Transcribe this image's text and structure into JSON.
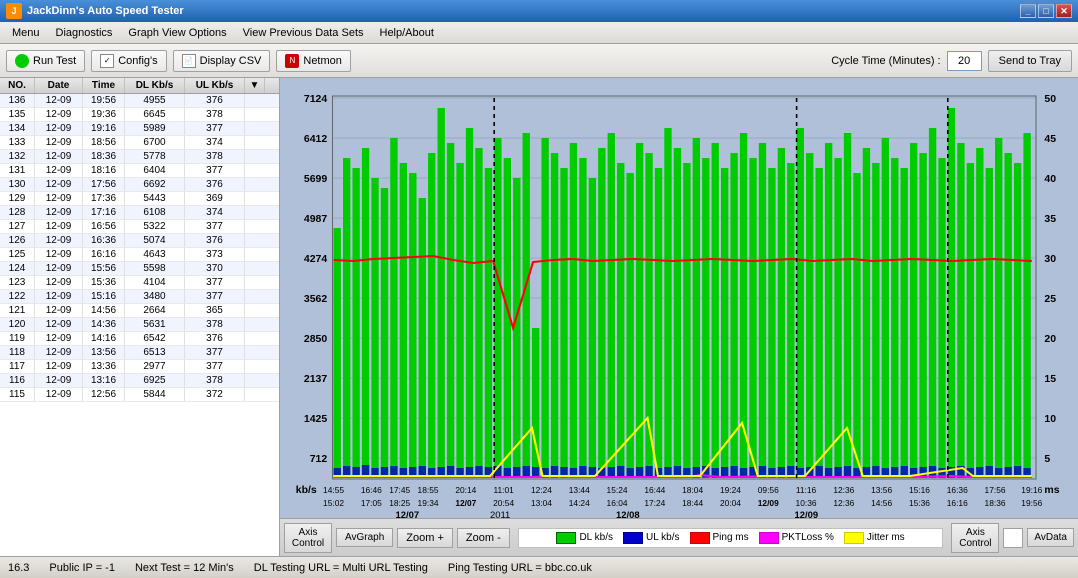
{
  "titlebar": {
    "title": "JackDinn's Auto Speed Tester",
    "controls": [
      "_",
      "□",
      "✕"
    ]
  },
  "menubar": {
    "items": [
      "Menu",
      "Diagnostics",
      "Graph View Options",
      "View Previous Data Sets",
      "Help/About"
    ]
  },
  "toolbar": {
    "run_test": "Run Test",
    "configs": "Config's",
    "display_csv": "Display CSV",
    "netmon": "Netmon",
    "cycle_time_label": "Cycle Time (Minutes) :",
    "cycle_time_value": "20",
    "send_to_tray": "Send to Tray"
  },
  "table": {
    "headers": [
      "NO.",
      "Date",
      "Time",
      "DL Kb/s",
      "UL Kb/s"
    ],
    "rows": [
      [
        "136",
        "12-09",
        "19:56",
        "4955",
        "376"
      ],
      [
        "135",
        "12-09",
        "19:36",
        "6645",
        "378"
      ],
      [
        "134",
        "12-09",
        "19:16",
        "5989",
        "377"
      ],
      [
        "133",
        "12-09",
        "18:56",
        "6700",
        "374"
      ],
      [
        "132",
        "12-09",
        "18:36",
        "5778",
        "378"
      ],
      [
        "131",
        "12-09",
        "18:16",
        "6404",
        "377"
      ],
      [
        "130",
        "12-09",
        "17:56",
        "6692",
        "376"
      ],
      [
        "129",
        "12-09",
        "17:36",
        "5443",
        "369"
      ],
      [
        "128",
        "12-09",
        "17:16",
        "6108",
        "374"
      ],
      [
        "127",
        "12-09",
        "16:56",
        "5322",
        "377"
      ],
      [
        "126",
        "12-09",
        "16:36",
        "5074",
        "376"
      ],
      [
        "125",
        "12-09",
        "16:16",
        "4643",
        "373"
      ],
      [
        "124",
        "12-09",
        "15:56",
        "5598",
        "370"
      ],
      [
        "123",
        "12-09",
        "15:36",
        "4104",
        "377"
      ],
      [
        "122",
        "12-09",
        "15:16",
        "3480",
        "377"
      ],
      [
        "121",
        "12-09",
        "14:56",
        "2664",
        "365"
      ],
      [
        "120",
        "12-09",
        "14:36",
        "5631",
        "378"
      ],
      [
        "119",
        "12-09",
        "14:16",
        "6542",
        "376"
      ],
      [
        "118",
        "12-09",
        "13:56",
        "6513",
        "377"
      ],
      [
        "117",
        "12-09",
        "13:36",
        "2977",
        "377"
      ],
      [
        "116",
        "12-09",
        "13:16",
        "6925",
        "378"
      ],
      [
        "115",
        "12-09",
        "12:56",
        "5844",
        "372"
      ]
    ]
  },
  "graph": {
    "y_labels_left": [
      "7124",
      "6412",
      "5699",
      "4987",
      "4274",
      "3562",
      "2850",
      "2137",
      "1425",
      "712",
      "kb/s"
    ],
    "y_labels_right": [
      "50",
      "45",
      "40",
      "35",
      "30",
      "25",
      "20",
      "15",
      "10",
      "5",
      "ms"
    ],
    "x_labels_top": [
      "14:55",
      "16:46",
      "17:45",
      "18:55",
      "20:14",
      "11:01",
      "12:24",
      "13:44",
      "15:24",
      "16:44",
      "18:04",
      "19:24",
      "09:56",
      "11:16",
      "12:36",
      "13:56",
      "15:16",
      "16:36",
      "17:56",
      "19:16"
    ],
    "x_labels_dates": [
      "15:02",
      "17:05",
      "18:25",
      "19:34",
      "12/07",
      "20:54",
      "13:04",
      "14:24",
      "16:04",
      "17:24",
      "18:44",
      "20:04",
      "12/09",
      "10:36",
      "12:36",
      "14:56",
      "15:36",
      "16:16",
      "18:36",
      "19:56"
    ],
    "date_markers": [
      "12/07",
      "12/08",
      "12/09"
    ],
    "year_label": "2011"
  },
  "legend": {
    "items": [
      {
        "label": "DL kb/s",
        "color": "#00cc00"
      },
      {
        "label": "UL kb/s",
        "color": "#0000ff"
      },
      {
        "label": "Ping ms",
        "color": "#ff0000"
      },
      {
        "label": "PKTLoss %",
        "color": "#ff00ff"
      },
      {
        "label": "Jitter ms",
        "color": "#ffff00"
      }
    ]
  },
  "bottom_controls": {
    "axis_control_left": "Axis\nControl",
    "avgraph": "AvGraph",
    "zoom_in": "Zoom +",
    "zoom_out": "Zoom -",
    "axis_control_right": "Axis\nControl",
    "avdata": "AvData"
  },
  "statusbar": {
    "version": "16.3",
    "public_ip": "Public IP = -1",
    "next_test": "Next Test = 12 Min's",
    "dl_url": "DL Testing URL = Multi URL Testing",
    "ping_url": "Ping Testing URL = bbc.co.uk"
  }
}
